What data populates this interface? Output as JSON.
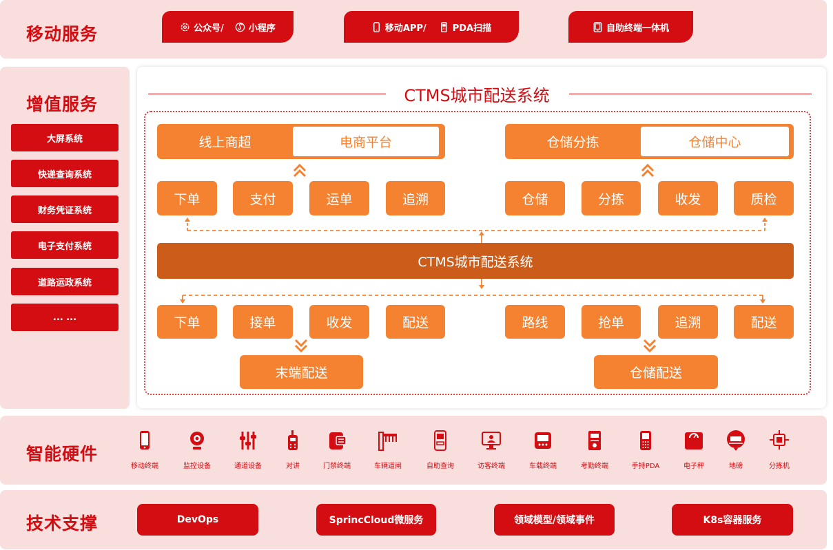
{
  "colors": {
    "red": "#d40d12",
    "band": "#f9dede",
    "orange": "#f58231",
    "dark_orange": "#cb5c1a"
  },
  "mobile": {
    "title": "移动服务",
    "pills": [
      {
        "items": [
          {
            "icon": "gear-icon",
            "label": "公众号/"
          },
          {
            "icon": "mini-program-icon",
            "label": "小程序"
          }
        ]
      },
      {
        "items": [
          {
            "icon": "phone-icon",
            "label": "移动APP/"
          },
          {
            "icon": "pda-icon",
            "label": "PDA扫描"
          }
        ]
      },
      {
        "items": [
          {
            "icon": "tablet-icon",
            "label": "自助终端一体机"
          }
        ]
      }
    ]
  },
  "value_added": {
    "title": "增值服务",
    "items": [
      "大屏系统",
      "快递查询系统",
      "财务凭证系统",
      "电子支付系统",
      "道路运政系统",
      "... ..."
    ]
  },
  "ctms": {
    "title": "CTMS城市配送系统",
    "left_header": {
      "left": "线上商超",
      "right": "电商平台"
    },
    "right_header": {
      "left": "仓储分拣",
      "right": "仓储中心"
    },
    "top_left_steps": [
      "下单",
      "支付",
      "运单",
      "追溯"
    ],
    "top_right_steps": [
      "仓储",
      "分拣",
      "收发",
      "质检"
    ],
    "core": "CTMS城市配送系统",
    "bottom_left_steps": [
      "下单",
      "接单",
      "收发",
      "配送"
    ],
    "bottom_right_steps": [
      "路线",
      "抢单",
      "追溯",
      "配送"
    ],
    "bottom_left_target": "末端配送",
    "bottom_right_target": "仓储配送"
  },
  "hardware": {
    "title": "智能硬件",
    "items": [
      {
        "icon": "mobile-terminal-icon",
        "label": "移动终端"
      },
      {
        "icon": "camera-icon",
        "label": "监控设备"
      },
      {
        "icon": "gate-icon",
        "label": "通道设备"
      },
      {
        "icon": "walkie-talkie-icon",
        "label": "对讲"
      },
      {
        "icon": "access-control-icon",
        "label": "门禁终端"
      },
      {
        "icon": "barrier-gate-icon",
        "label": "车辆道闸"
      },
      {
        "icon": "kiosk-icon",
        "label": "自助查询"
      },
      {
        "icon": "visitor-terminal-icon",
        "label": "访客终端"
      },
      {
        "icon": "vehicle-terminal-icon",
        "label": "车载终端"
      },
      {
        "icon": "attendance-icon",
        "label": "考勤终端"
      },
      {
        "icon": "handheld-pda-icon",
        "label": "手持PDA"
      },
      {
        "icon": "scale-icon",
        "label": "电子秤"
      },
      {
        "icon": "weighbridge-icon",
        "label": "地磅"
      },
      {
        "icon": "sorter-icon",
        "label": "分拣机"
      }
    ]
  },
  "tech": {
    "title": "技术支撑",
    "items": [
      "DevOps",
      "SprincCloud微服务",
      "领域模型/领域事件",
      "K8s容器服务"
    ]
  }
}
